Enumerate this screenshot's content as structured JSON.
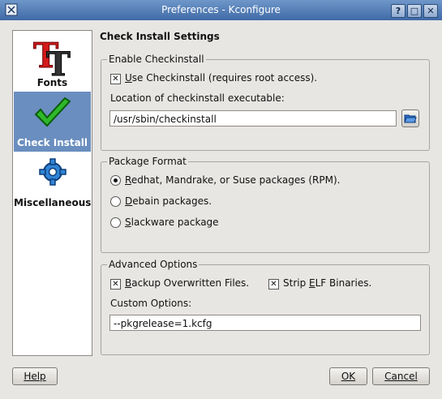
{
  "window": {
    "title": "Preferences - Kconfigure"
  },
  "titlebar_buttons": {
    "help": "?",
    "maximize": "□",
    "close": "✕"
  },
  "sidebar": {
    "items": [
      {
        "label": "Fonts",
        "icon": "fonts-icon"
      },
      {
        "label": "Check Install",
        "icon": "checkmark-icon",
        "selected": true
      },
      {
        "label": "Miscellaneous",
        "icon": "gear-icon"
      }
    ]
  },
  "content": {
    "title": "Check Install Settings",
    "enable": {
      "legend": "Enable Checkinstall",
      "use_checkbox": {
        "label_u": "U",
        "label_rest": "se Checkinstall (requires root access).",
        "checked": true
      },
      "location_label": "Location of checkinstall executable:",
      "location_value": "/usr/sbin/checkinstall"
    },
    "package": {
      "legend": "Package Format",
      "options": [
        {
          "label_u": "R",
          "label_rest": "edhat, Mandrake, or Suse packages (RPM).",
          "checked": true
        },
        {
          "label_u": "D",
          "label_rest": "ebain packages.",
          "checked": false
        },
        {
          "label_u": "S",
          "label_rest": "lackware package",
          "checked": false
        }
      ]
    },
    "advanced": {
      "legend": "Advanced Options",
      "backup": {
        "label_u": "B",
        "label_rest": "ackup Overwritten Files.",
        "checked": true
      },
      "strip": {
        "label_pre": "Strip ",
        "label_u": "E",
        "label_rest": "LF Binaries.",
        "checked": true
      },
      "custom_label": "Custom Options:",
      "custom_value": "--pkgrelease=1.kcfg"
    }
  },
  "buttons": {
    "help": "Help",
    "ok": "OK",
    "cancel": "Cancel"
  }
}
